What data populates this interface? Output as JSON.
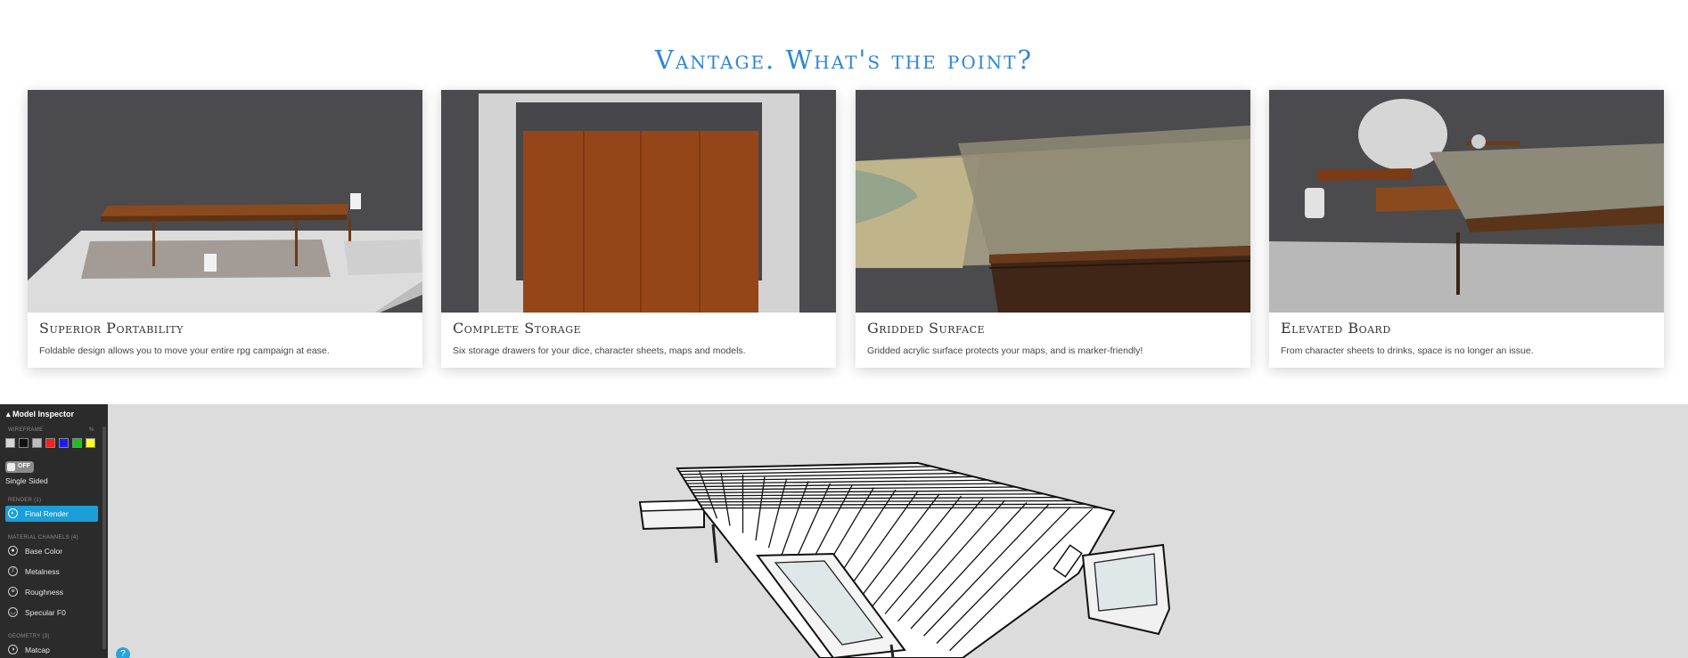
{
  "section_title": "Vantage. What's the point?",
  "cards": [
    {
      "title": "Superior Portability",
      "description": "Foldable design allows you to move your entire rpg campaign at ease."
    },
    {
      "title": "Complete Storage",
      "description": "Six storage drawers for your dice, character sheets, maps and models."
    },
    {
      "title": "Gridded Surface",
      "description": "Gridded acrylic surface protects your maps, and is marker-friendly!"
    },
    {
      "title": "Elevated Board",
      "description": "From character sheets to drinks, space is no longer an issue."
    }
  ],
  "inspector": {
    "title": "Model Inspector",
    "wireframe_label": "WIREFRAME",
    "wireframe_value": "%",
    "wireframe_colors": [
      "#d8d8d8",
      "#111111",
      "#bdbdbd",
      "#ff1c1c",
      "#1c1cff",
      "#19c219",
      "#ffff1a"
    ],
    "single_sided_toggle": "OFF",
    "single_sided_label": "Single Sided",
    "render_section": "RENDER (1)",
    "render_items": [
      {
        "label": "Final Render",
        "icon": "render-icon"
      }
    ],
    "material_section": "MATERIAL CHANNELS (4)",
    "material_items": [
      {
        "label": "Base Color",
        "icon": "palette-icon"
      },
      {
        "label": "Metalness",
        "icon": "metalness-icon"
      },
      {
        "label": "Roughness",
        "icon": "roughness-icon"
      },
      {
        "label": "Specular F0",
        "icon": "specular-icon"
      }
    ],
    "geometry_section": "GEOMETRY (3)",
    "geometry_items": [
      {
        "label": "Matcap",
        "icon": "matcap-icon"
      }
    ]
  },
  "colors": {
    "heading": "#2f86d6",
    "accent": "#1a9fd8",
    "viewer_bg": "#dcdcdc",
    "panel_bg": "#2b2b2c"
  }
}
